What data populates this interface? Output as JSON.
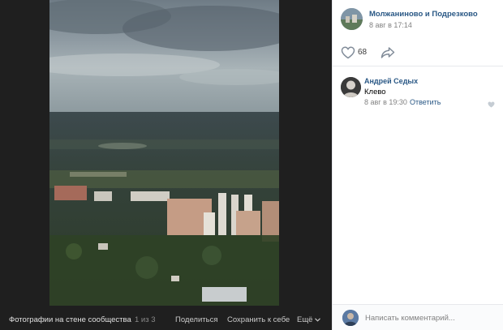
{
  "bottombar": {
    "album_title": "Фотографии на стене сообщества",
    "counter": "1 из 3",
    "share_label": "Поделиться",
    "save_label": "Сохранить к себе",
    "more_label": "Ещё"
  },
  "post": {
    "community_name": "Молжаниново и Подрезково",
    "date": "8 авг в 17:14",
    "likes_count": "68",
    "comments": [
      {
        "author": "Андрей Седых",
        "text": "Клево",
        "date": "8 авг в 19:30",
        "reply_label": "Ответить"
      }
    ]
  },
  "compose": {
    "placeholder": "Написать комментарий..."
  },
  "icons": {
    "like": "heart-icon",
    "share": "share-arrow-icon",
    "more": "chevron-down-icon",
    "comment_like": "heart-icon"
  },
  "colors": {
    "link": "#2a5885",
    "viewer_bg": "#1f1f1f",
    "meta": "#828282"
  }
}
